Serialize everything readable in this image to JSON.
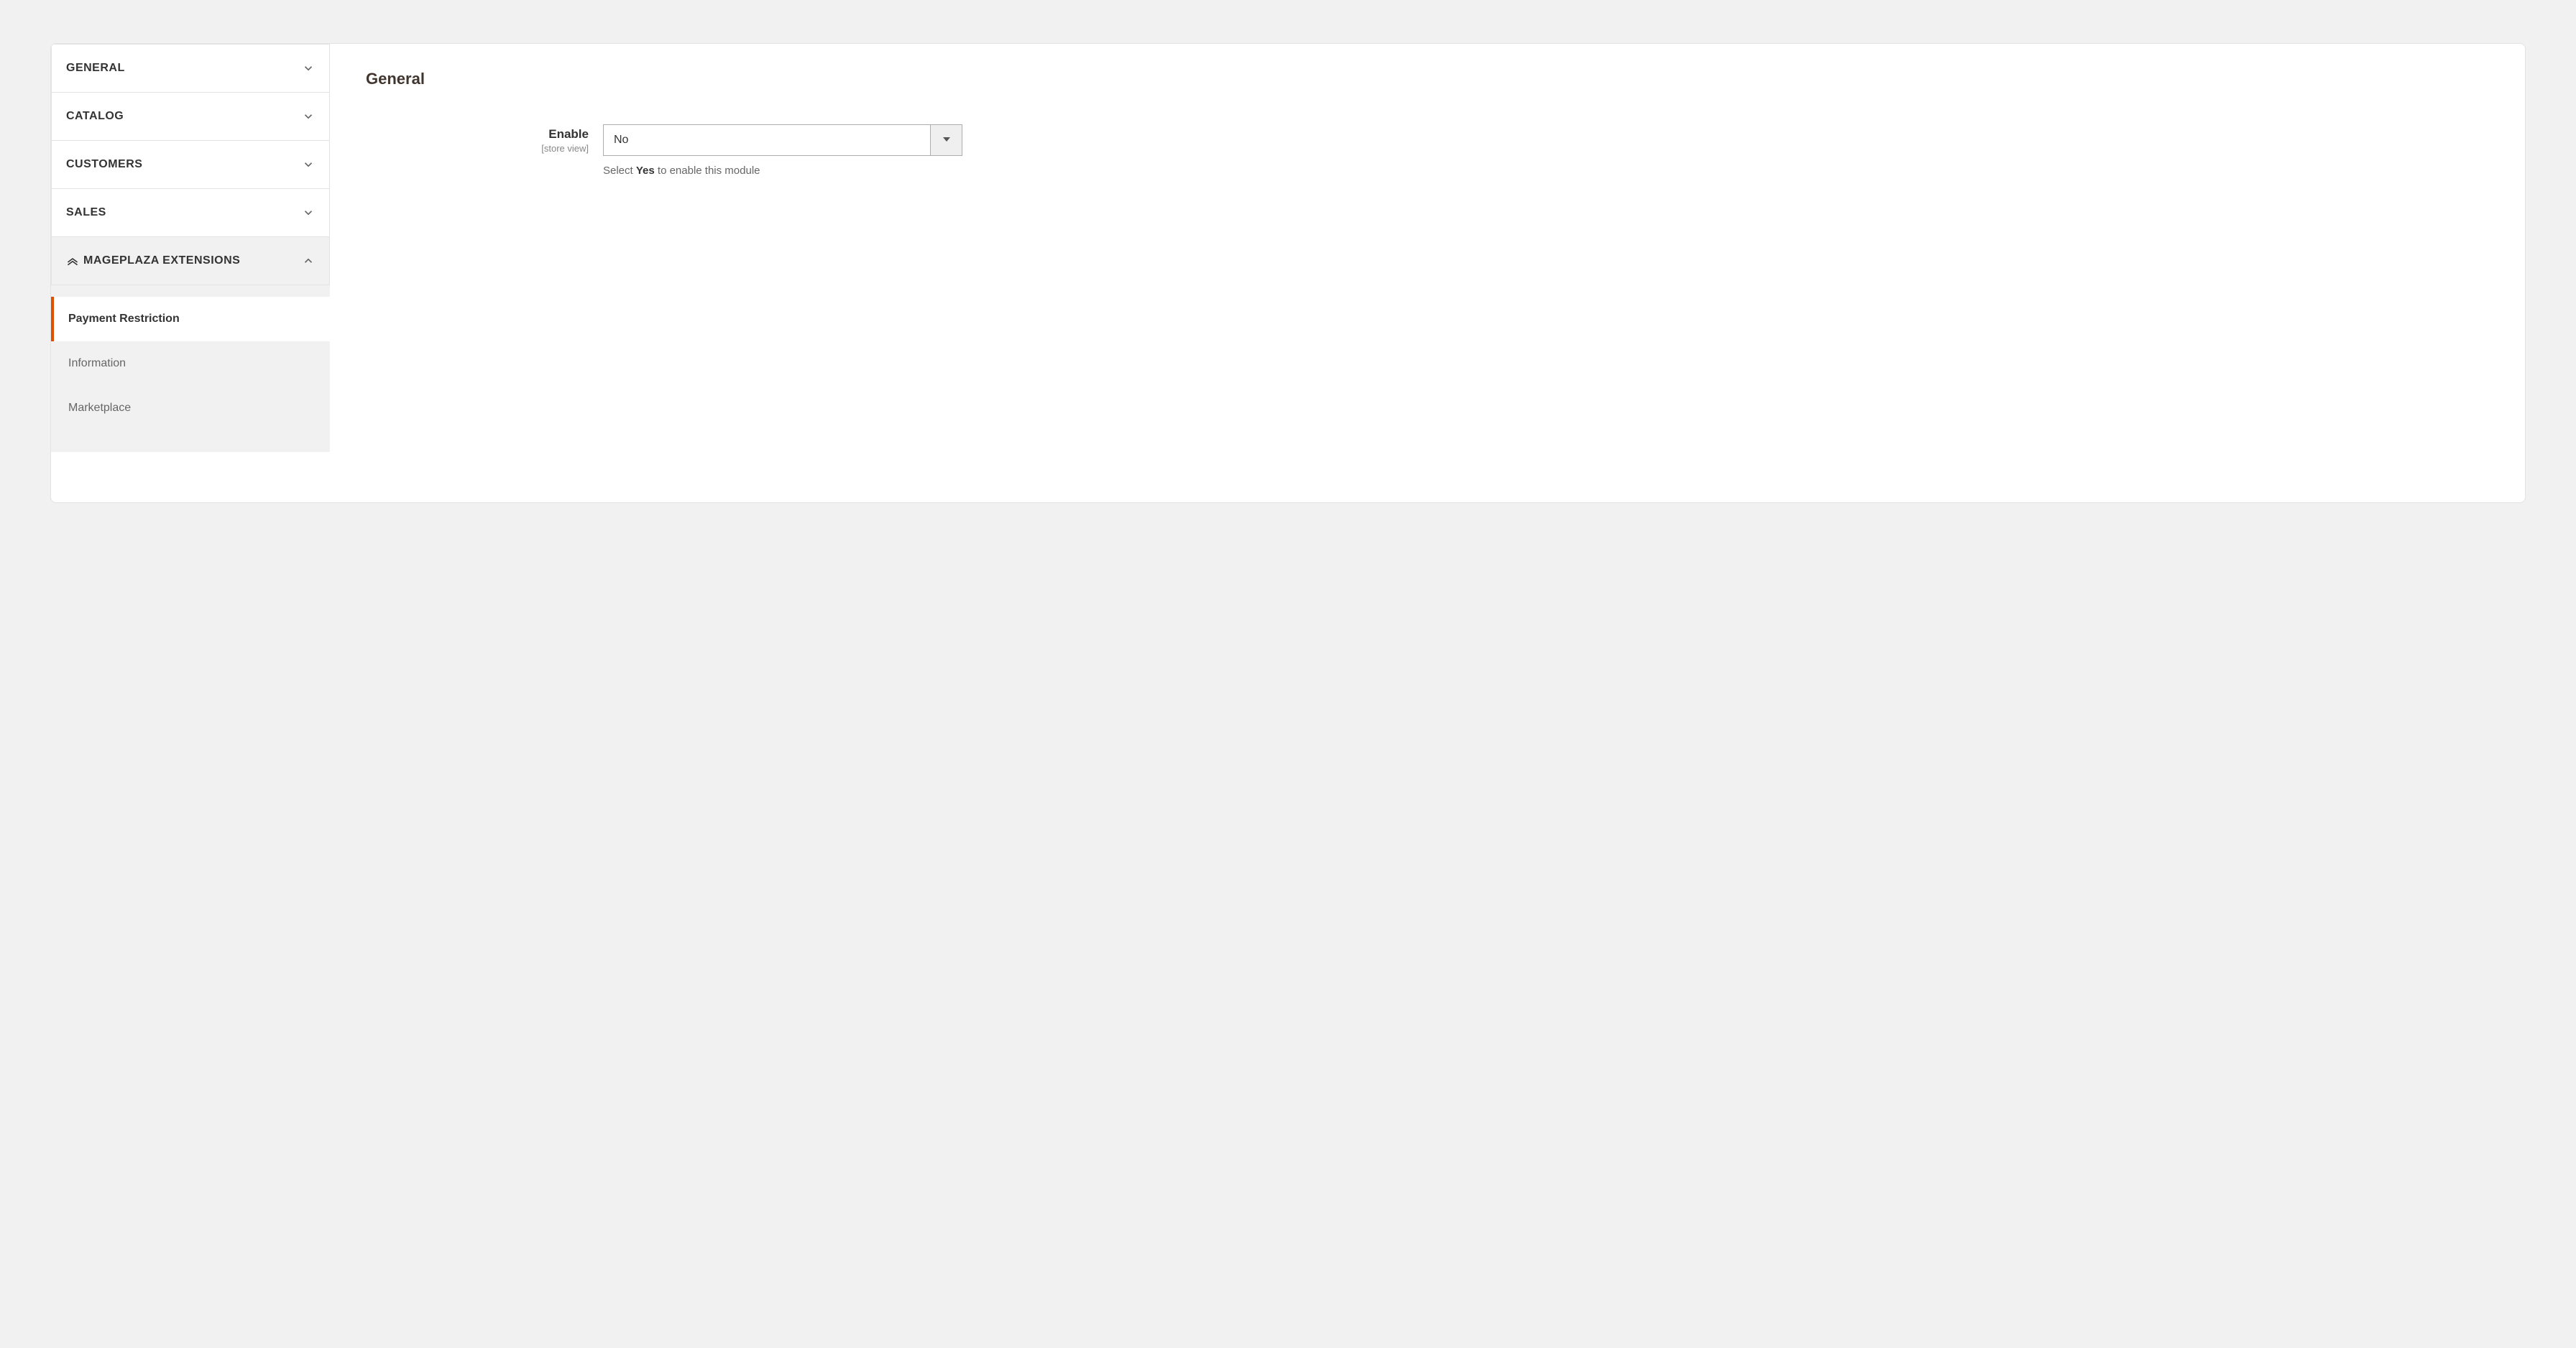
{
  "sidebar": {
    "tabs": [
      {
        "label": "GENERAL",
        "expanded": false
      },
      {
        "label": "CATALOG",
        "expanded": false
      },
      {
        "label": "CUSTOMERS",
        "expanded": false
      },
      {
        "label": "SALES",
        "expanded": false
      },
      {
        "label": "MAGEPLAZA EXTENSIONS",
        "expanded": true
      }
    ],
    "subitems": [
      {
        "label": "Payment Restriction",
        "active": true
      },
      {
        "label": "Information",
        "active": false
      },
      {
        "label": "Marketplace",
        "active": false
      }
    ]
  },
  "content": {
    "section_title": "General",
    "field": {
      "label": "Enable",
      "scope": "[store view]",
      "value": "No",
      "note_pre": "Select ",
      "note_bold": "Yes",
      "note_post": " to enable this module"
    }
  }
}
